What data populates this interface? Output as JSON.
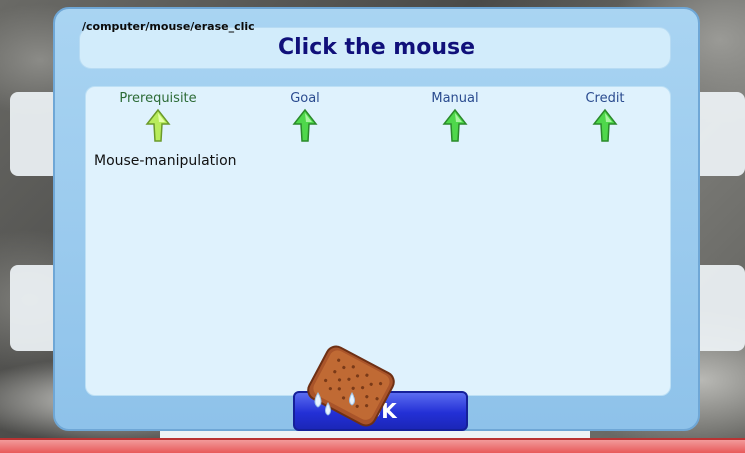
{
  "dialog": {
    "path": "/computer/mouse/erase_clic",
    "title": "Click the mouse",
    "tabs": [
      {
        "label": "Prerequisite",
        "icon": "arrow-up-icon",
        "color": "#b8ec5c",
        "active": true
      },
      {
        "label": "Goal",
        "icon": "arrow-up-icon",
        "color": "#4fd84b",
        "active": false
      },
      {
        "label": "Manual",
        "icon": "arrow-up-icon",
        "color": "#4fd84b",
        "active": false
      },
      {
        "label": "Credit",
        "icon": "arrow-up-icon",
        "color": "#4fd84b",
        "active": false
      }
    ],
    "content_text": "Mouse-manipulation",
    "ok_label": "OK"
  },
  "cursor": {
    "icon": "sponge-icon"
  },
  "colors": {
    "dialog_bg": "#a9d4f2",
    "title_color": "#10107a",
    "button_blue": "#2330d6",
    "bottom_bar": "#e85a5a"
  }
}
